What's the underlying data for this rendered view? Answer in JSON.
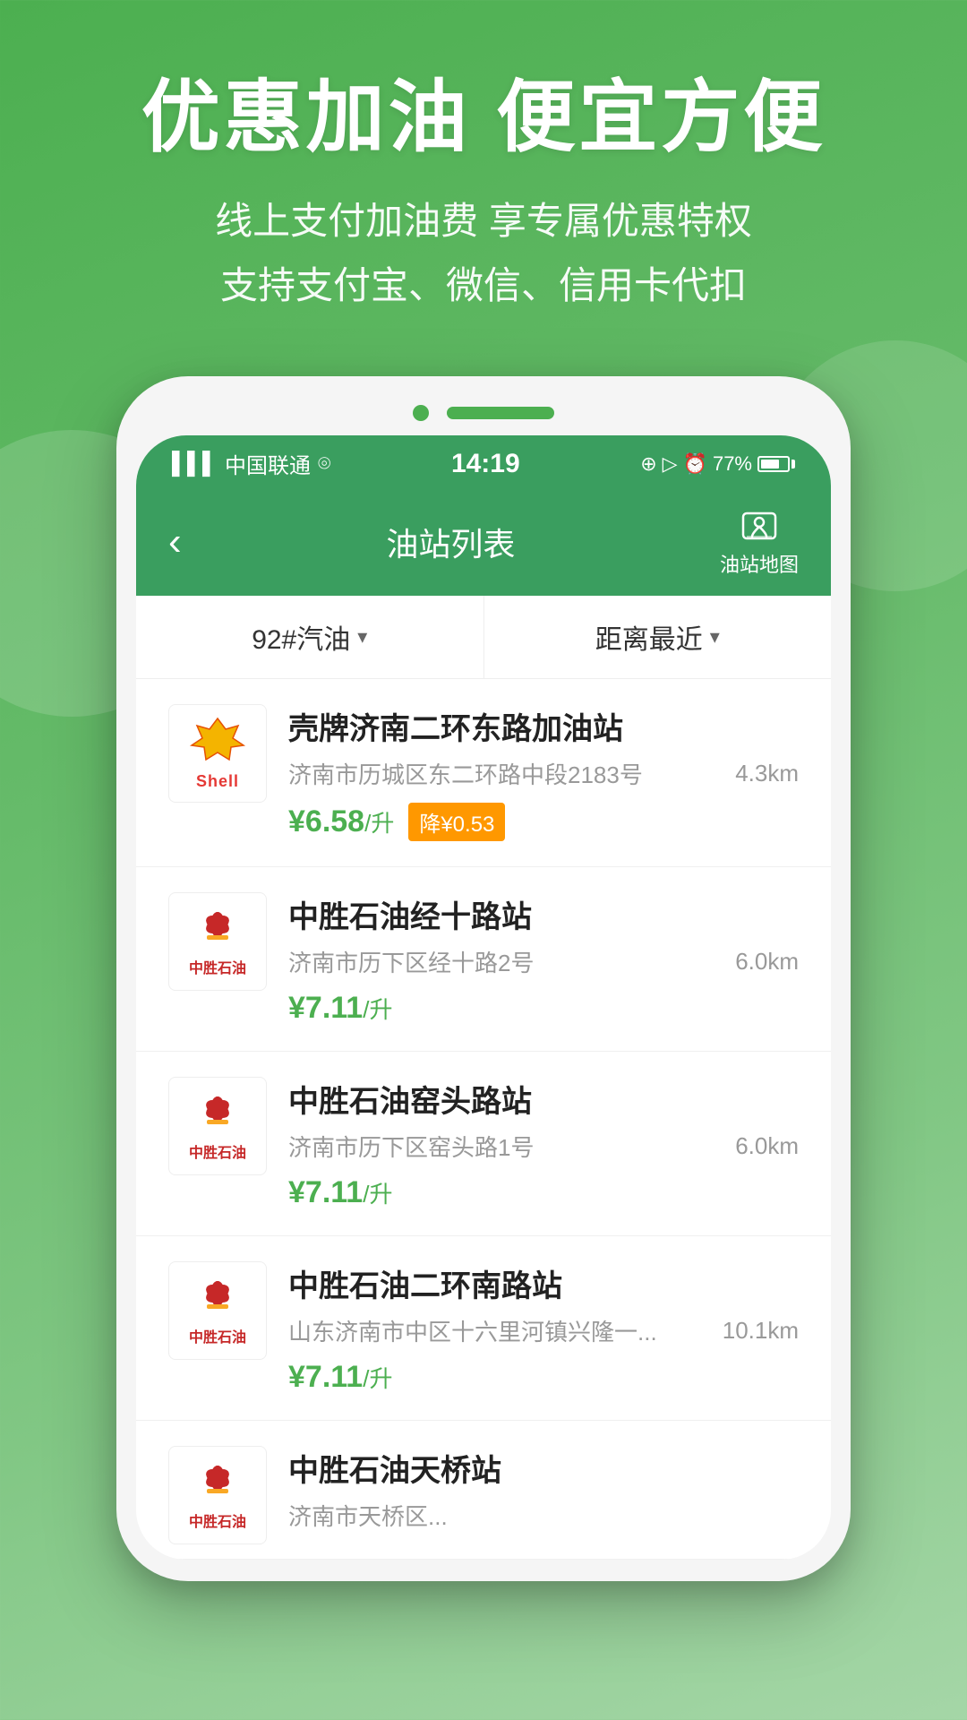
{
  "hero": {
    "title": "优惠加油 便宜方便",
    "subtitle_line1": "线上支付加油费 享专属优惠特权",
    "subtitle_line2": "支持支付宝、微信、信用卡代扣"
  },
  "status_bar": {
    "carrier": "中国联通",
    "wifi": "WiFi",
    "time": "14:19",
    "battery": "77%"
  },
  "header": {
    "back_label": "‹",
    "title": "油站列表",
    "map_label": "油站地图"
  },
  "filters": {
    "fuel_type": "92#汽油",
    "sort": "距离最近"
  },
  "stations": [
    {
      "name": "壳牌济南二环东路加油站",
      "address": "济南市历城区东二环路中段2183号",
      "distance": "4.3km",
      "price": "¥6.58",
      "unit": "/升",
      "discount": "降¥0.53",
      "brand": "shell"
    },
    {
      "name": "中胜石油经十路站",
      "address": "济南市历下区经十路2号",
      "distance": "6.0km",
      "price": "¥7.11",
      "unit": "/升",
      "discount": "",
      "brand": "zhongsheng"
    },
    {
      "name": "中胜石油窑头路站",
      "address": "济南市历下区窑头路1号",
      "distance": "6.0km",
      "price": "¥7.11",
      "unit": "/升",
      "discount": "",
      "brand": "zhongsheng"
    },
    {
      "name": "中胜石油二环南路站",
      "address": "山东济南市中区十六里河镇兴隆一...",
      "distance": "10.1km",
      "price": "¥7.11",
      "unit": "/升",
      "discount": "",
      "brand": "zhongsheng"
    },
    {
      "name": "中胜石油天桥站",
      "address": "济南市天桥区...",
      "distance": "",
      "price": "",
      "unit": "",
      "discount": "",
      "brand": "zhongsheng"
    }
  ]
}
